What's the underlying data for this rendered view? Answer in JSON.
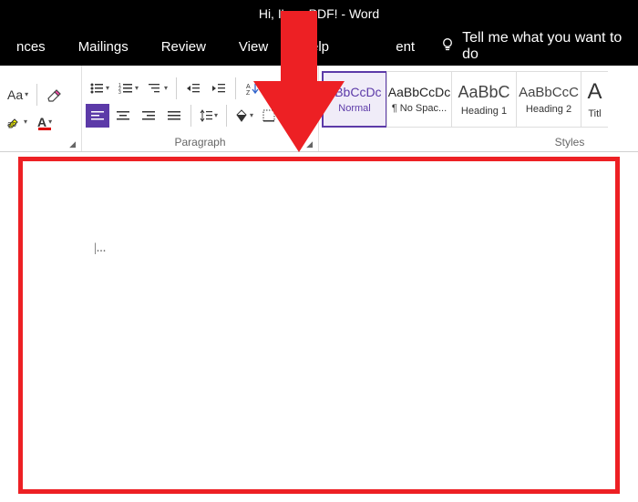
{
  "title": "Hi, I'm a PDF!  -  Word",
  "menu": {
    "items": [
      "nces",
      "Mailings",
      "Review",
      "View",
      "Help",
      "",
      "ent"
    ],
    "tellme": "Tell me what you want to do"
  },
  "ribbon": {
    "font": {
      "changecase": "Aa",
      "color": "A"
    },
    "paragraph": {
      "label": "Paragraph"
    },
    "styles": {
      "label": "Styles",
      "items": [
        {
          "preview": "aBbCcDc",
          "label": "Normal"
        },
        {
          "preview": "AaBbCcDc",
          "label": "¶ No Spac..."
        },
        {
          "preview": "AaBbC",
          "label": "Heading 1"
        },
        {
          "preview": "AaBbCcC",
          "label": "Heading 2"
        },
        {
          "preview": "A",
          "label": "Titl"
        }
      ]
    }
  },
  "doc": {
    "cursor": "|..."
  }
}
